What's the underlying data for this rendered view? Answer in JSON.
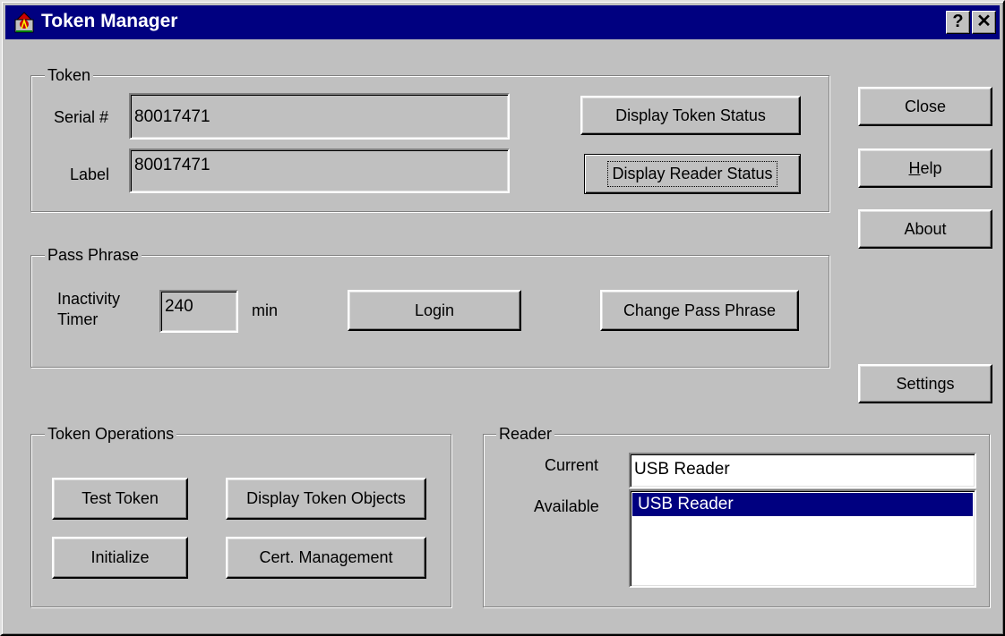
{
  "window": {
    "title": "Token Manager",
    "caption_help": "?",
    "caption_close": "✕"
  },
  "colors": {
    "face": "#c0c0c0",
    "titlebar": "#000080",
    "selection": "#000080"
  },
  "token": {
    "group_label": "Token",
    "serial_label": "Serial #",
    "serial_value": "80017471",
    "label_label": "Label",
    "label_value": "80017471",
    "display_token_status": "Display Token Status",
    "display_reader_status": "Display Reader Status"
  },
  "pass_phrase": {
    "group_label": "Pass Phrase",
    "inactivity_line1": "Inactivity",
    "inactivity_line2": "Timer",
    "timer_value": "240",
    "timer_unit": "min",
    "login": "Login",
    "change_pass_phrase": "Change Pass Phrase"
  },
  "side_buttons": {
    "close": "Close",
    "help_mnemonic": "H",
    "help_rest": "elp",
    "about": "About",
    "settings": "Settings"
  },
  "token_operations": {
    "group_label": "Token Operations",
    "test_token": "Test Token",
    "display_token_objects": "Display Token Objects",
    "initialize": "Initialize",
    "cert_management": "Cert. Management"
  },
  "reader": {
    "group_label": "Reader",
    "current_label": "Current",
    "current_value": "USB Reader",
    "available_label": "Available",
    "available_items": [
      "USB Reader"
    ],
    "selected_index": 0
  }
}
